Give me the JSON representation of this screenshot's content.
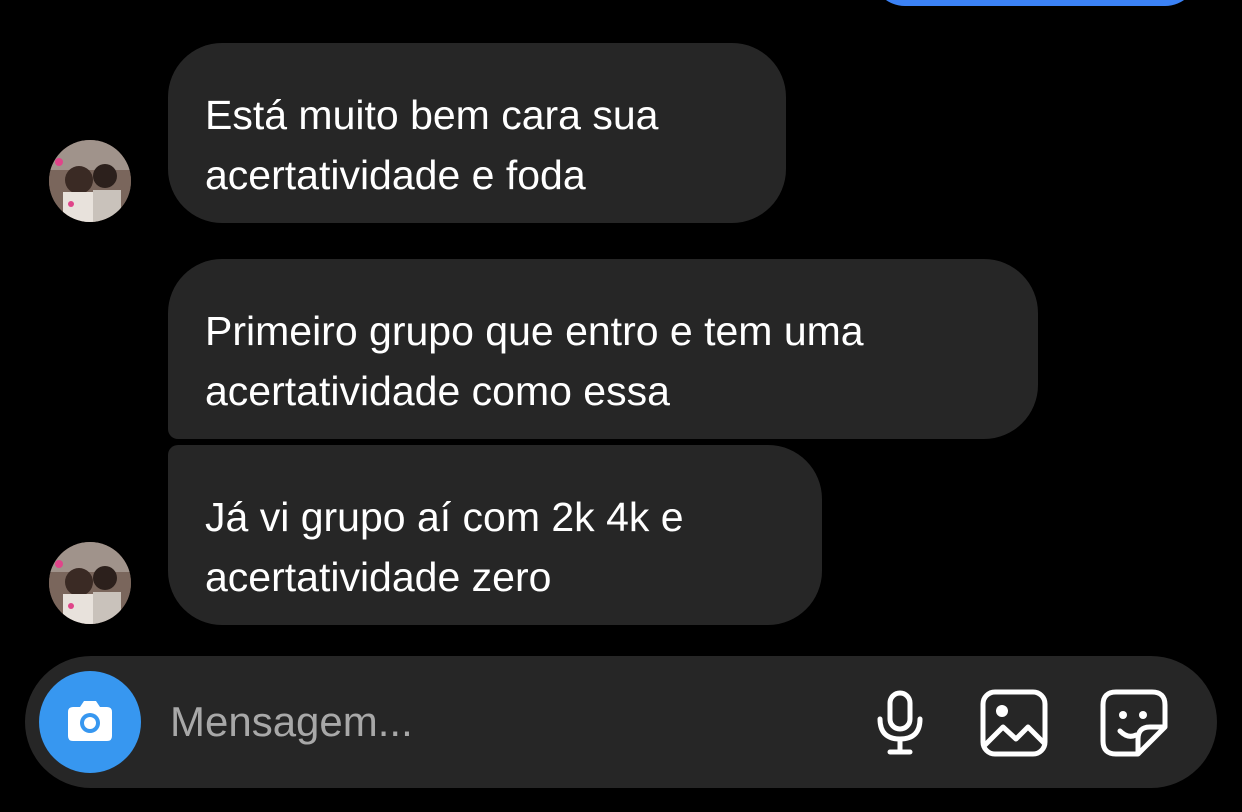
{
  "conversation": {
    "messages": [
      {
        "lines": [
          "Está muito bem cara sua",
          "acertatividade e foda"
        ]
      },
      {
        "lines": [
          "Primeiro grupo que entro e tem uma",
          "acertatividade como essa"
        ]
      },
      {
        "lines": [
          "Já vi grupo aí com 2k 4k e",
          "acertatividade zero"
        ]
      }
    ]
  },
  "composer": {
    "placeholder": "Mensagem...",
    "icons": {
      "camera": "camera-icon",
      "microphone": "microphone-icon",
      "gallery": "gallery-icon",
      "sticker": "sticker-icon"
    }
  },
  "colors": {
    "background": "#000000",
    "received_bubble": "#262626",
    "sent_bubble": "#3b82f6",
    "camera_button": "#3797f0",
    "placeholder": "#a8a8a8"
  }
}
